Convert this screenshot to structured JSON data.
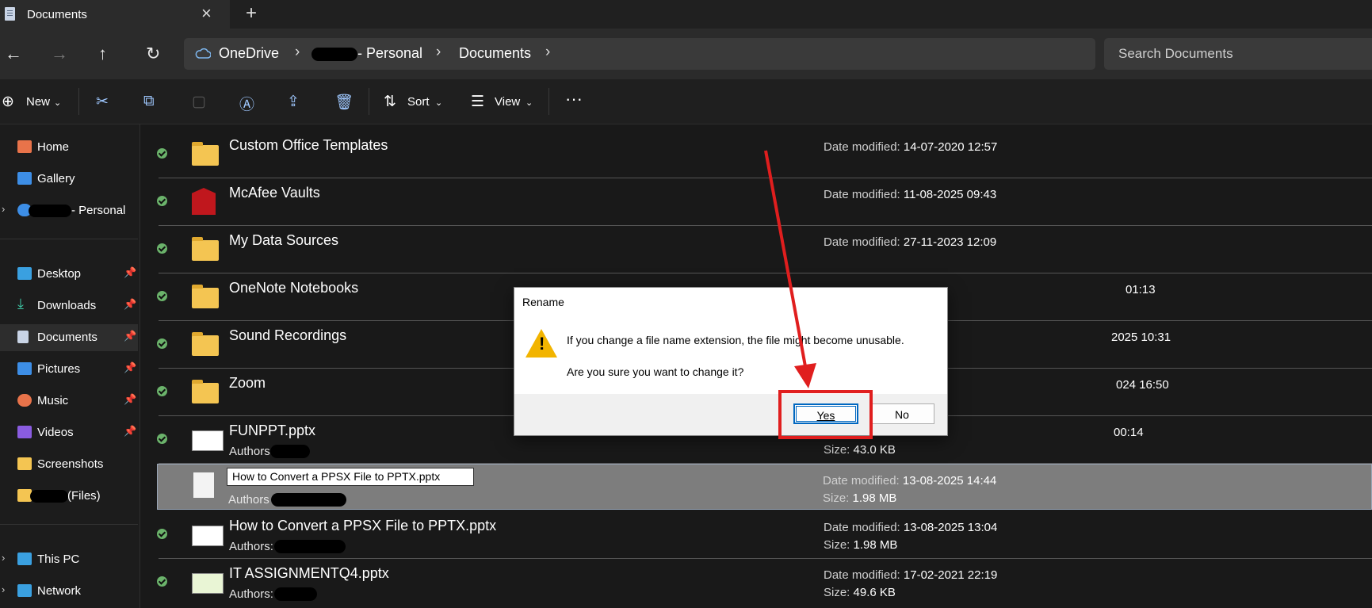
{
  "window": {
    "tab_title": "Documents"
  },
  "breadcrumb": {
    "root": "OneDrive",
    "personal": "- Personal",
    "current": "Documents"
  },
  "search": {
    "placeholder": "Search Documents"
  },
  "toolbar": {
    "new_label": "New",
    "sort_label": "Sort",
    "view_label": "View"
  },
  "sidebar": {
    "home": "Home",
    "gallery": "Gallery",
    "onedrive_personal": "- Personal",
    "desktop": "Desktop",
    "downloads": "Downloads",
    "documents": "Documents",
    "pictures": "Pictures",
    "music": "Music",
    "videos": "Videos",
    "screenshots": "Screenshots",
    "files": "(Files)",
    "this_pc": "This PC",
    "network": "Network"
  },
  "files": [
    {
      "name": "Custom Office Templates",
      "modified_label": "Date modified:",
      "modified": "14-07-2020 12:57"
    },
    {
      "name": "McAfee Vaults",
      "modified_label": "Date modified:",
      "modified": "11-08-2025 09:43"
    },
    {
      "name": "My Data Sources",
      "modified_label": "Date modified:",
      "modified": "27-11-2023 12:09"
    },
    {
      "name": "OneNote Notebooks",
      "modified": "01:13"
    },
    {
      "name": "Sound Recordings",
      "modified": "2025 10:31"
    },
    {
      "name": "Zoom",
      "modified": "024 16:50"
    },
    {
      "name": "FUNPPT.pptx",
      "authors_label": "Authors",
      "modified": "00:14",
      "size_label": "Size:",
      "size": "43.0 KB"
    },
    {
      "name": "How to Convert a PPSX File to PPTX.pptx",
      "authors_label": "Authors",
      "modified_label": "Date modified:",
      "modified": "13-08-2025 14:44",
      "size_label": "Size:",
      "size": "1.98 MB"
    },
    {
      "name": "How to Convert a PPSX File to PPTX.pptx",
      "authors_label": "Authors:",
      "modified_label": "Date modified:",
      "modified": "13-08-2025 13:04",
      "size_label": "Size:",
      "size": "1.98 MB"
    },
    {
      "name": "IT ASSIGNMENTQ4.pptx",
      "authors_label": "Authors:",
      "modified_label": "Date modified:",
      "modified": "17-02-2021 22:19",
      "size_label": "Size:",
      "size": "49.6 KB"
    }
  ],
  "dialog": {
    "title": "Rename",
    "message": "If you change a file name extension, the file might become unusable.",
    "question": "Are you sure you want to change it?",
    "yes": "Yes",
    "no": "No"
  },
  "colors": {
    "highlight": "#e01e1e",
    "accent": "#0067c0"
  }
}
